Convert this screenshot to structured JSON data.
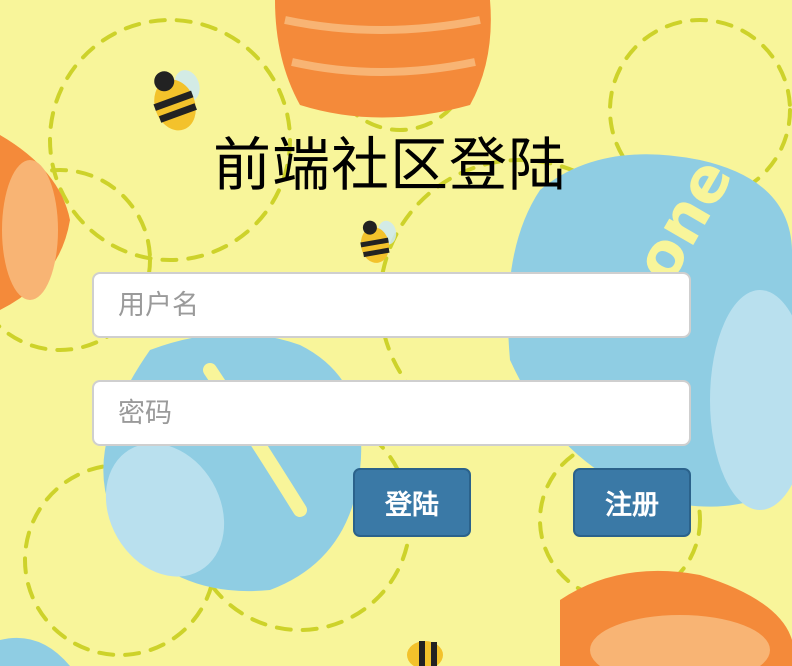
{
  "colors": {
    "background": "#f8f59a",
    "honey_pot_orange": "#f48a3a",
    "honey_pot_blue": "#8fcde3",
    "button": "#3a79a6"
  },
  "login_form": {
    "title": "前端社区登陆",
    "username_placeholder": "用户名",
    "password_placeholder": "密码",
    "login_label": "登陆",
    "register_label": "注册"
  },
  "background": {
    "pot_lettering": "honey"
  }
}
